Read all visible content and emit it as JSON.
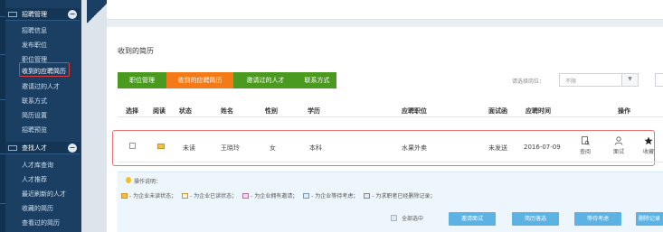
{
  "sidebar": {
    "sections": [
      {
        "label": "招聘管理",
        "toggle": "−"
      },
      {
        "label": "查找人才",
        "toggle": "−"
      }
    ],
    "items": [
      {
        "label": "招聘信息"
      },
      {
        "label": "发布职位"
      },
      {
        "label": "职位管理"
      },
      {
        "label": "收到的应聘简历"
      },
      {
        "label": "邀请过的人才"
      },
      {
        "label": "联系方式"
      },
      {
        "label": "简历设置"
      },
      {
        "label": "招聘预览"
      },
      {
        "label": "人才库查询"
      },
      {
        "label": "人才推荐"
      },
      {
        "label": "最近刷新的人才"
      },
      {
        "label": "收藏的简历"
      },
      {
        "label": "查看过的简历"
      }
    ]
  },
  "page": {
    "title": "收到的简历"
  },
  "tabs": [
    {
      "label": "职位管理",
      "color": "#4a9a1f"
    },
    {
      "label": "收到的应聘简历",
      "color": "#f47a18"
    },
    {
      "label": "邀请过的人才",
      "color": "#4a9a1f"
    },
    {
      "label": "联系方式",
      "color": "#4a9a1f"
    }
  ],
  "filter": {
    "label": "请选择岗位：",
    "value": "不限",
    "arrow": "▼"
  },
  "table": {
    "headers": [
      "选择",
      "阅读",
      "状态",
      "姓名",
      "性别",
      "学历",
      "应聘职位",
      "面试函",
      "应聘时间",
      "操作"
    ],
    "rows": [
      {
        "status": "未读",
        "name": "王晓玲",
        "gender": "女",
        "education": "本科",
        "position": "水果外卖",
        "interview": "未发送",
        "date": "2016-07-09"
      }
    ],
    "actions": [
      {
        "label": "查阅",
        "icon": "view-doc-icon"
      },
      {
        "label": "面试",
        "icon": "interview-person-icon"
      },
      {
        "label": "收藏",
        "icon": "star-icon"
      }
    ]
  },
  "notes": {
    "title": "操作说明：",
    "legend": [
      "- 为企业未读状态；",
      "- 为企业已读状态；",
      "- 为企业拥有邀请；",
      "- 为企业等待考虑；",
      "- 为求职者已经删除记录；"
    ]
  },
  "footer": {
    "select_all": "全部选中",
    "buttons": [
      "邀请面试",
      "简历落选",
      "等待考虑",
      "删除记录"
    ]
  },
  "colors": {
    "sidebar": "#1b3f62",
    "accent_orange": "#f47a18",
    "accent_green": "#4a9a1f",
    "button_blue": "#5bb2e3",
    "highlight_red": "#e23b3b"
  }
}
